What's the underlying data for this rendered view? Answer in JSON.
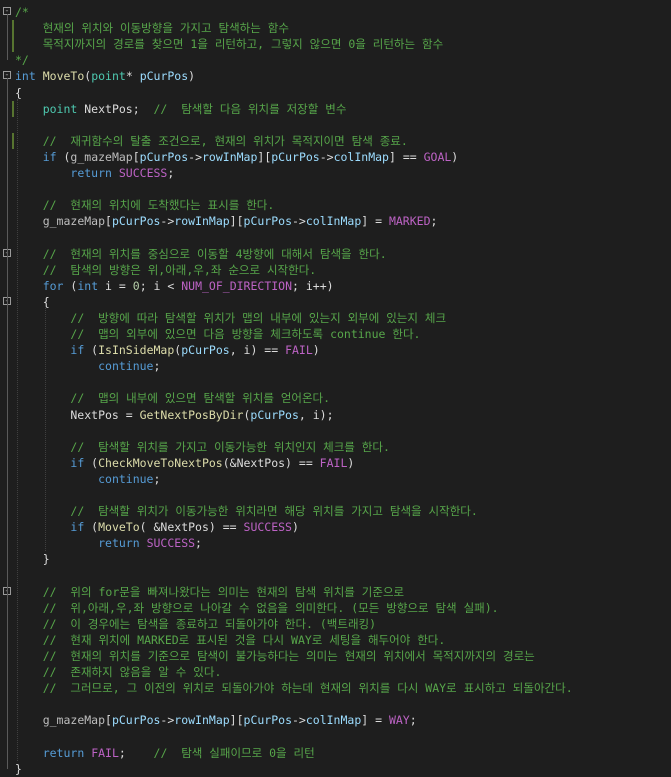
{
  "lines": [
    [
      [
        "comment",
        "/*"
      ]
    ],
    [
      [
        "comment",
        "    현재의 위치와 이동방향을 가지고 탐색하는 함수"
      ]
    ],
    [
      [
        "comment",
        "    목적지까지의 경로를 찾으면 1을 리턴하고, 그렇지 않으면 0을 리턴하는 함수"
      ]
    ],
    [
      [
        "comment",
        "*/"
      ]
    ],
    [
      [
        "kw",
        "int"
      ],
      [
        "text",
        " "
      ],
      [
        "fn",
        "MoveTo"
      ],
      [
        "text",
        "("
      ],
      [
        "type",
        "point"
      ],
      [
        "text",
        "* "
      ],
      [
        "var",
        "pCurPos"
      ],
      [
        "text",
        ")"
      ]
    ],
    [
      [
        "text",
        "{"
      ]
    ],
    [
      [
        "text",
        "    "
      ],
      [
        "type",
        "point"
      ],
      [
        "text",
        " NextPos;  "
      ],
      [
        "comment",
        "//  탐색할 다음 위치를 저장할 변수"
      ]
    ],
    [],
    [
      [
        "text",
        "    "
      ],
      [
        "comment",
        "//  재귀함수의 탈출 조건으로, 현재의 위치가 목적지이면 탐색 종료."
      ]
    ],
    [
      [
        "text",
        "    "
      ],
      [
        "kw",
        "if"
      ],
      [
        "text",
        " ("
      ],
      [
        "gvar",
        "g_mazeMap"
      ],
      [
        "text",
        "["
      ],
      [
        "var",
        "pCurPos"
      ],
      [
        "text",
        "->"
      ],
      [
        "var",
        "rowInMap"
      ],
      [
        "text",
        "]["
      ],
      [
        "var",
        "pCurPos"
      ],
      [
        "text",
        "->"
      ],
      [
        "var",
        "colInMap"
      ],
      [
        "text",
        "] == "
      ],
      [
        "macro",
        "GOAL"
      ],
      [
        "text",
        ")"
      ]
    ],
    [
      [
        "text",
        "        "
      ],
      [
        "kw",
        "return"
      ],
      [
        "text",
        " "
      ],
      [
        "macro",
        "SUCCESS"
      ],
      [
        "text",
        ";"
      ]
    ],
    [],
    [
      [
        "text",
        "    "
      ],
      [
        "comment",
        "//  현재의 위치에 도착했다는 표시를 한다."
      ]
    ],
    [
      [
        "text",
        "    "
      ],
      [
        "gvar",
        "g_mazeMap"
      ],
      [
        "text",
        "["
      ],
      [
        "var",
        "pCurPos"
      ],
      [
        "text",
        "->"
      ],
      [
        "var",
        "rowInMap"
      ],
      [
        "text",
        "]["
      ],
      [
        "var",
        "pCurPos"
      ],
      [
        "text",
        "->"
      ],
      [
        "var",
        "colInMap"
      ],
      [
        "text",
        "] = "
      ],
      [
        "macro",
        "MARKED"
      ],
      [
        "text",
        ";"
      ]
    ],
    [],
    [
      [
        "text",
        "    "
      ],
      [
        "comment",
        "//  현재의 위치를 중심으로 이동할 4방향에 대해서 탐색을 한다."
      ]
    ],
    [
      [
        "text",
        "    "
      ],
      [
        "comment",
        "//  탐색의 방향은 위,아래,우,좌 순으로 시작한다."
      ]
    ],
    [
      [
        "text",
        "    "
      ],
      [
        "kw",
        "for"
      ],
      [
        "text",
        " ("
      ],
      [
        "kw",
        "int"
      ],
      [
        "text",
        " i = "
      ],
      [
        "num",
        "0"
      ],
      [
        "text",
        "; i < "
      ],
      [
        "macro",
        "NUM_OF_DIRECTION"
      ],
      [
        "text",
        "; i++)"
      ]
    ],
    [
      [
        "text",
        "    {"
      ]
    ],
    [
      [
        "text",
        "        "
      ],
      [
        "comment",
        "//  방향에 따라 탐색할 위치가 맵의 내부에 있는지 외부에 있는지 체크"
      ]
    ],
    [
      [
        "text",
        "        "
      ],
      [
        "comment",
        "//  맵의 외부에 있으면 다음 방향을 체크하도록 continue 한다."
      ]
    ],
    [
      [
        "text",
        "        "
      ],
      [
        "kw",
        "if"
      ],
      [
        "text",
        " ("
      ],
      [
        "fn",
        "IsInSideMap"
      ],
      [
        "text",
        "("
      ],
      [
        "var",
        "pCurPos"
      ],
      [
        "text",
        ", i) == "
      ],
      [
        "macro",
        "FAIL"
      ],
      [
        "text",
        ")"
      ]
    ],
    [
      [
        "text",
        "            "
      ],
      [
        "kw",
        "continue"
      ],
      [
        "text",
        ";"
      ]
    ],
    [],
    [
      [
        "text",
        "        "
      ],
      [
        "comment",
        "//  맵의 내부에 있으면 탐색할 위치를 얻어온다."
      ]
    ],
    [
      [
        "text",
        "        NextPos = "
      ],
      [
        "fn",
        "GetNextPosByDir"
      ],
      [
        "text",
        "("
      ],
      [
        "var",
        "pCurPos"
      ],
      [
        "text",
        ", i);"
      ]
    ],
    [],
    [
      [
        "text",
        "        "
      ],
      [
        "comment",
        "//  탐색할 위치를 가지고 이동가능한 위치인지 체크를 한다."
      ]
    ],
    [
      [
        "text",
        "        "
      ],
      [
        "kw",
        "if"
      ],
      [
        "text",
        " ("
      ],
      [
        "fn",
        "CheckMoveToNextPos"
      ],
      [
        "text",
        "(&NextPos) == "
      ],
      [
        "macro",
        "FAIL"
      ],
      [
        "text",
        ")"
      ]
    ],
    [
      [
        "text",
        "            "
      ],
      [
        "kw",
        "continue"
      ],
      [
        "text",
        ";"
      ]
    ],
    [],
    [
      [
        "text",
        "        "
      ],
      [
        "comment",
        "//  탐색할 위치가 이동가능한 위치라면 해당 위치를 가지고 탐색을 시작한다."
      ]
    ],
    [
      [
        "text",
        "        "
      ],
      [
        "kw",
        "if"
      ],
      [
        "text",
        " ("
      ],
      [
        "fn",
        "MoveTo"
      ],
      [
        "text",
        "( &NextPos) == "
      ],
      [
        "macro",
        "SUCCESS"
      ],
      [
        "text",
        ")"
      ]
    ],
    [
      [
        "text",
        "            "
      ],
      [
        "kw",
        "return"
      ],
      [
        "text",
        " "
      ],
      [
        "macro",
        "SUCCESS"
      ],
      [
        "text",
        ";"
      ]
    ],
    [
      [
        "text",
        "    }"
      ]
    ],
    [],
    [
      [
        "text",
        "    "
      ],
      [
        "comment",
        "//  위의 for문을 빠져나왔다는 의미는 현재의 탐색 위치를 기준으로"
      ]
    ],
    [
      [
        "text",
        "    "
      ],
      [
        "comment",
        "//  위,아래,우,좌 방향으로 나아갈 수 없음을 의미한다. (모든 방향으로 탐색 실패)."
      ]
    ],
    [
      [
        "text",
        "    "
      ],
      [
        "comment",
        "//  이 경우에는 탐색을 종료하고 되돌아가야 한다. (백트래킹)"
      ]
    ],
    [
      [
        "text",
        "    "
      ],
      [
        "comment",
        "//  현재 위치에 MARKED로 표시된 것을 다시 WAY로 세팅을 해두어야 한다."
      ]
    ],
    [
      [
        "text",
        "    "
      ],
      [
        "comment",
        "//  현재의 위치를 기준으로 탐색이 불가능하다는 의미는 현재의 위치에서 목적지까지의 경로는"
      ]
    ],
    [
      [
        "text",
        "    "
      ],
      [
        "comment",
        "//  존재하지 않음을 알 수 있다."
      ]
    ],
    [
      [
        "text",
        "    "
      ],
      [
        "comment",
        "//  그러므로, 그 이전의 위치로 되돌아가야 하는데 현재의 위치를 다시 WAY로 표시하고 되돌아간다."
      ]
    ],
    [],
    [
      [
        "text",
        "    "
      ],
      [
        "gvar",
        "g_mazeMap"
      ],
      [
        "text",
        "["
      ],
      [
        "var",
        "pCurPos"
      ],
      [
        "text",
        "->"
      ],
      [
        "var",
        "rowInMap"
      ],
      [
        "text",
        "]["
      ],
      [
        "var",
        "pCurPos"
      ],
      [
        "text",
        "->"
      ],
      [
        "var",
        "colInMap"
      ],
      [
        "text",
        "] = "
      ],
      [
        "macro",
        "WAY"
      ],
      [
        "text",
        ";"
      ]
    ],
    [],
    [
      [
        "text",
        "    "
      ],
      [
        "kw",
        "return"
      ],
      [
        "text",
        " "
      ],
      [
        "macro",
        "FAIL"
      ],
      [
        "text",
        ";    "
      ],
      [
        "comment",
        "//  탐색 실패이므로 0을 리턴"
      ]
    ],
    [
      [
        "text",
        "}"
      ]
    ]
  ],
  "fold_markers": {
    "0": "-",
    "4": "-",
    "15": "-",
    "18": "-",
    "36": "-"
  }
}
